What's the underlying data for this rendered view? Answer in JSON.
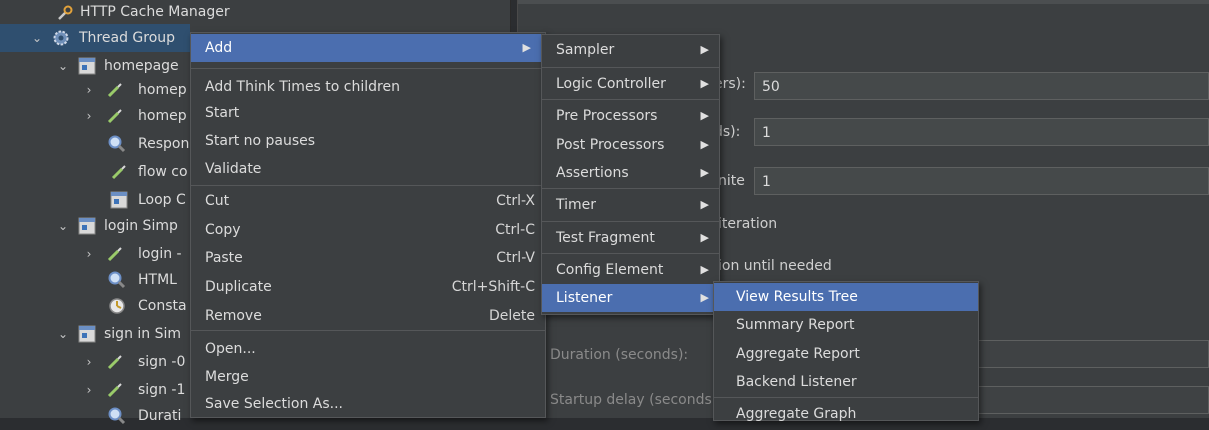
{
  "tree": {
    "items": [
      {
        "label": "HTTP Cache Manager"
      },
      {
        "label": "Thread Group"
      },
      {
        "label": "homepage"
      },
      {
        "label": "homep"
      },
      {
        "label": "homep"
      },
      {
        "label": "Respon"
      },
      {
        "label": "flow co"
      },
      {
        "label": "Loop C"
      },
      {
        "label": "login Simp"
      },
      {
        "label": "login -"
      },
      {
        "label": "HTML"
      },
      {
        "label": "Consta"
      },
      {
        "label": "sign in Sim"
      },
      {
        "label": "sign -0"
      },
      {
        "label": "sign -1"
      },
      {
        "label": "Durati"
      }
    ]
  },
  "form": {
    "threads_label": "ers):",
    "threads_value": "50",
    "rampup_label": "ds):",
    "rampup_value": "1",
    "loop_label": "nite",
    "loop_value": "1",
    "same_user_text": "iteration",
    "delay_text": "ion until needed",
    "duration_label": "Duration (seconds):",
    "startup_label": "Startup delay (seconds"
  },
  "context_menu": {
    "items": [
      {
        "label": "Add",
        "shortcut": ""
      },
      {
        "label": "Add Think Times to children",
        "shortcut": ""
      },
      {
        "label": "Start",
        "shortcut": ""
      },
      {
        "label": "Start no pauses",
        "shortcut": ""
      },
      {
        "label": "Validate",
        "shortcut": ""
      },
      {
        "label": "Cut",
        "shortcut": "Ctrl-X"
      },
      {
        "label": "Copy",
        "shortcut": "Ctrl-C"
      },
      {
        "label": "Paste",
        "shortcut": "Ctrl-V"
      },
      {
        "label": "Duplicate",
        "shortcut": "Ctrl+Shift-C"
      },
      {
        "label": "Remove",
        "shortcut": "Delete"
      },
      {
        "label": "Open...",
        "shortcut": ""
      },
      {
        "label": "Merge",
        "shortcut": ""
      },
      {
        "label": "Save Selection As...",
        "shortcut": ""
      }
    ]
  },
  "add_submenu": {
    "items": [
      {
        "label": "Sampler"
      },
      {
        "label": "Logic Controller"
      },
      {
        "label": "Pre Processors"
      },
      {
        "label": "Post Processors"
      },
      {
        "label": "Assertions"
      },
      {
        "label": "Timer"
      },
      {
        "label": "Test Fragment"
      },
      {
        "label": "Config Element"
      },
      {
        "label": "Listener"
      }
    ]
  },
  "listener_submenu": {
    "items": [
      {
        "label": "View Results Tree"
      },
      {
        "label": "Summary Report"
      },
      {
        "label": "Aggregate Report"
      },
      {
        "label": "Backend Listener"
      },
      {
        "label": "Aggregate Graph"
      }
    ]
  },
  "colors": {
    "background": "#3c3f41",
    "selection": "#4b6eaf",
    "tree_selection": "#2f4f6f"
  },
  "icons": {
    "arrow": "▶",
    "expanded": "⌄",
    "collapsed": "›"
  }
}
